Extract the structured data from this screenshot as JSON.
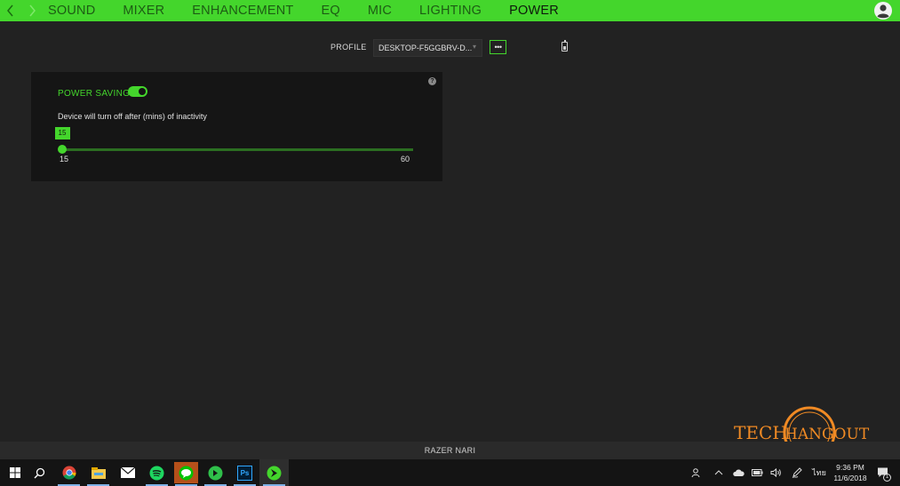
{
  "nav": {
    "tabs": [
      "SOUND",
      "MIXER",
      "ENHANCEMENT",
      "EQ",
      "MIC",
      "LIGHTING",
      "POWER"
    ],
    "active_tab": "POWER"
  },
  "profile": {
    "label": "PROFILE",
    "value": "DESKTOP-F5GGBRV-D...",
    "more_label": "•••"
  },
  "power": {
    "title": "POWER SAVING",
    "enabled": true,
    "help_label": "?",
    "description": "Device will turn off after (mins) of inactivity",
    "slider": {
      "min": 15,
      "max": 60,
      "value": 15,
      "value_label": "15",
      "min_label": "15",
      "max_label": "60"
    }
  },
  "footer": {
    "device": "RAZER NARI"
  },
  "watermark": {
    "text_tech": "TECH",
    "text_hangout": "HANGOUT"
  },
  "taskbar": {
    "apps": [
      "start-icon",
      "search-icon",
      "chrome-icon",
      "file-explorer-icon",
      "mail-icon",
      "spotify-icon",
      "line-icon",
      "app-icon",
      "photoshop-icon",
      "razer-synapse-icon"
    ],
    "photoshop_label": "Ps",
    "language": "ไทย",
    "time": "9:36 PM",
    "date": "11/6/2018",
    "notification_count": "1"
  },
  "colors": {
    "accent": "#44d62c",
    "background": "#222222",
    "card": "#151515"
  }
}
